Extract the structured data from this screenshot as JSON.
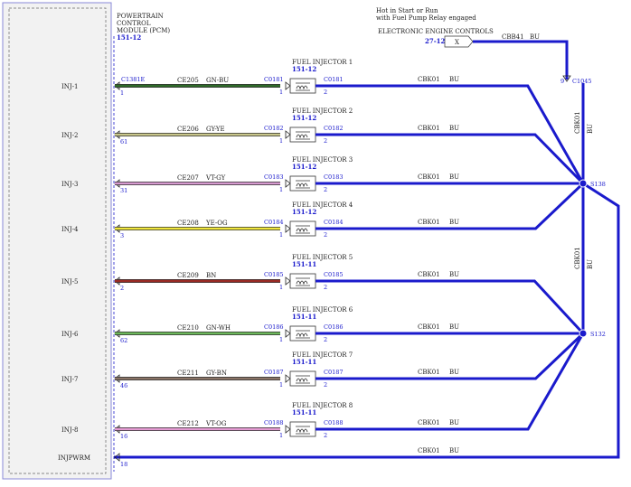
{
  "pcm": {
    "line1": "POWERTRAIN",
    "line2": "CONTROL",
    "line3": "MODULE (PCM)",
    "ref": "151-12",
    "connector": "C1381E"
  },
  "power": {
    "note1": "Hot in Start or Run",
    "note2": "with Fuel Pump Relay engaged",
    "source_label": "ELECTRONIC ENGINE CONTROLS",
    "source_ref": "27-12",
    "source_pin": "X",
    "wire": "CBB41",
    "color": "BU",
    "connector": "C1045",
    "connector_pin": "9"
  },
  "splices": {
    "top": "S138",
    "bottom": "S132",
    "feed_top_wire": "CBK01",
    "feed_top_color": "BU",
    "feed_bottom_wire": "CBK01",
    "feed_bottom_color": "BU"
  },
  "injectors": [
    {
      "pcm_label": "INJ-1",
      "pcm_pin": "1",
      "wire": "CE205",
      "color": "GN-BU",
      "name": "FUEL INJECTOR 1",
      "ref": "151-12",
      "conn": "C0181",
      "pin_in": "1",
      "pin_out": "2",
      "feed": "CBK01",
      "feed_color": "BU",
      "wire_hex": "#2f6b2a"
    },
    {
      "pcm_label": "INJ-2",
      "pcm_pin": "61",
      "wire": "CE206",
      "color": "GY-YE",
      "name": "FUEL INJECTOR 2",
      "ref": "151-12",
      "conn": "C0182",
      "pin_in": "1",
      "pin_out": "2",
      "feed": "CBK01",
      "feed_color": "BU",
      "wire_hex": "#c8c68a"
    },
    {
      "pcm_label": "INJ-3",
      "pcm_pin": "31",
      "wire": "CE207",
      "color": "VT-GY",
      "name": "FUEL INJECTOR 3",
      "ref": "151-12",
      "conn": "C0183",
      "pin_in": "1",
      "pin_out": "2",
      "feed": "CBK01",
      "feed_color": "BU",
      "wire_hex": "#d79ad0"
    },
    {
      "pcm_label": "INJ-4",
      "pcm_pin": "3",
      "wire": "CE208",
      "color": "YE-OG",
      "name": "FUEL INJECTOR 4",
      "ref": "151-12",
      "conn": "C0184",
      "pin_in": "1",
      "pin_out": "2",
      "feed": "CBK01",
      "feed_color": "BU",
      "wire_hex": "#f0e63c"
    },
    {
      "pcm_label": "INJ-5",
      "pcm_pin": "2",
      "wire": "CE209",
      "color": "BN",
      "name": "FUEL INJECTOR 5",
      "ref": "151-11",
      "conn": "C0185",
      "pin_in": "1",
      "pin_out": "2",
      "feed": "CBK01",
      "feed_color": "BU",
      "wire_hex": "#9a2b25"
    },
    {
      "pcm_label": "INJ-6",
      "pcm_pin": "62",
      "wire": "CE210",
      "color": "GN-WH",
      "name": "FUEL INJECTOR 6",
      "ref": "151-11",
      "conn": "C0186",
      "pin_in": "1",
      "pin_out": "2",
      "feed": "CBK01",
      "feed_color": "BU",
      "wire_hex": "#6cb85a"
    },
    {
      "pcm_label": "INJ-7",
      "pcm_pin": "46",
      "wire": "CE211",
      "color": "GY-BN",
      "name": "FUEL INJECTOR 7",
      "ref": "151-11",
      "conn": "C0187",
      "pin_in": "1",
      "pin_out": "2",
      "feed": "CBK01",
      "feed_color": "BU",
      "wire_hex": "#8a7466"
    },
    {
      "pcm_label": "INJ-8",
      "pcm_pin": "16",
      "wire": "CE212",
      "color": "VT-OG",
      "name": "FUEL INJECTOR 8",
      "ref": "151-11",
      "conn": "C0188",
      "pin_in": "1",
      "pin_out": "2",
      "feed": "CBK01",
      "feed_color": "BU",
      "wire_hex": "#e49ad2"
    }
  ],
  "injpwrm": {
    "label": "INJPWRM",
    "pin": "18",
    "wire": "CBK01",
    "color": "BU"
  }
}
